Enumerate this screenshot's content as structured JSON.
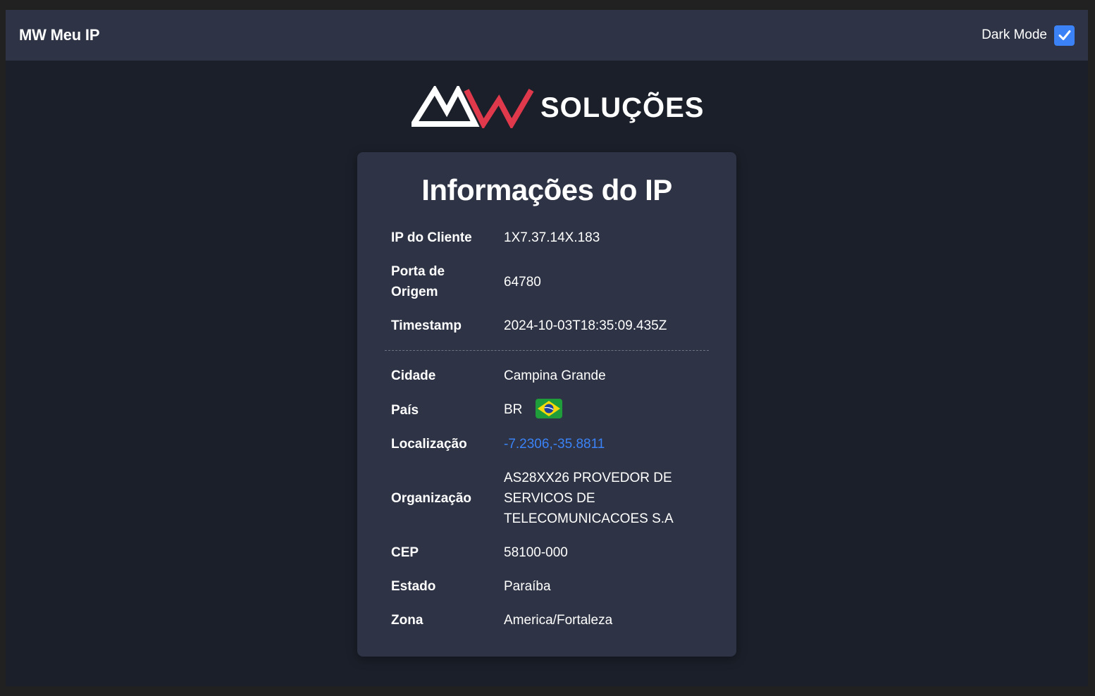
{
  "navbar": {
    "brand": "MW Meu IP",
    "dark_mode_label": "Dark Mode",
    "dark_mode_checked": true
  },
  "logo": {
    "text": "SOLUÇÕES"
  },
  "card": {
    "title": "Informações do IP",
    "connection": [
      {
        "label": "IP do Cliente",
        "value": "1X7.37.14X.183"
      },
      {
        "label": "Porta de Origem",
        "value": "64780"
      },
      {
        "label": "Timestamp",
        "value": "2024-10-03T18:35:09.435Z"
      }
    ],
    "geo": [
      {
        "label": "Cidade",
        "value": "Campina Grande"
      },
      {
        "label": "País",
        "value": "BR",
        "icon": "brazil-flag-icon"
      },
      {
        "label": "Localização",
        "value": "-7.2306,-35.8811",
        "link": true
      },
      {
        "label": "Organização",
        "value": "AS28XX26 PROVEDOR DE SERVICOS DE TELECOMUNICACOES S.A"
      },
      {
        "label": "CEP",
        "value": "58100-000"
      },
      {
        "label": "Estado",
        "value": "Paraíba"
      },
      {
        "label": "Zona",
        "value": "America/Fortaleza"
      }
    ]
  },
  "colors": {
    "page_bg": "#1b1f29",
    "surface": "#2e3445",
    "accent_blue": "#3b82f6",
    "logo_red": "#e0394c"
  }
}
